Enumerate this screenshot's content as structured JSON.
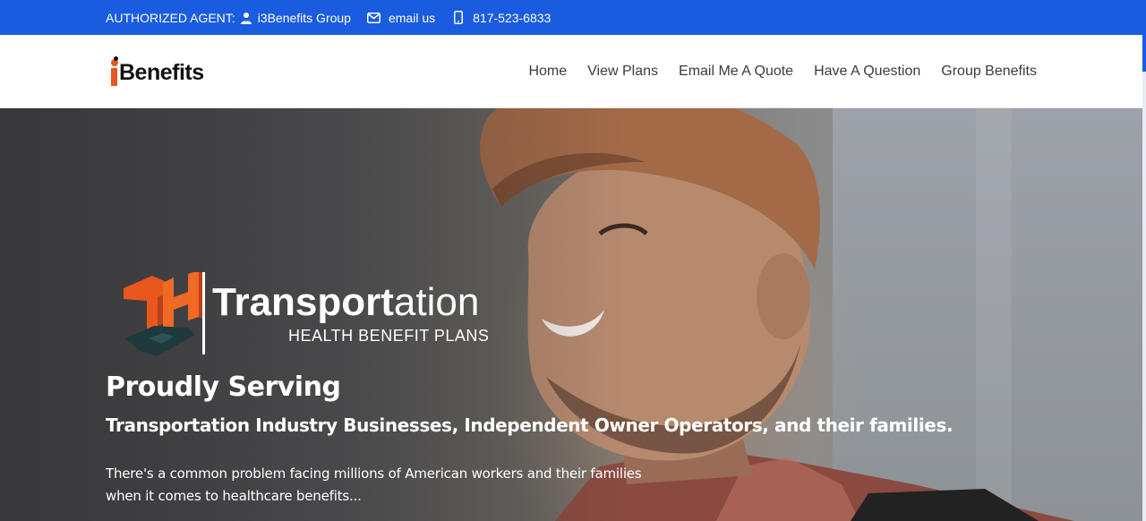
{
  "topbar": {
    "agent_label": "AUTHORIZED AGENT:",
    "agent_name": "i3Benefits Group",
    "email_label": "email us",
    "phone": "817-523-6833",
    "bg_color": "#1a5ce0",
    "icons": [
      "user-tie-icon",
      "envelope-icon",
      "mobile-phone-icon"
    ]
  },
  "header": {
    "logo_text": "Benefits",
    "nav": [
      {
        "label": "Home"
      },
      {
        "label": "View Plans"
      },
      {
        "label": "Email Me A Quote"
      },
      {
        "label": "Have A Question"
      },
      {
        "label": "Group Benefits"
      }
    ]
  },
  "hero": {
    "brand_bold": "Transport",
    "brand_light": "ation",
    "brand_subtitle": "HEALTH BENEFIT PLANS",
    "brand_mark_colors": {
      "orange": "#e8571d",
      "dark": "#1f3a3d"
    },
    "heading": "Proudly Serving",
    "subheading": "Transportation Industry Businesses, Independent Owner Operators, and their families.",
    "body_line1": "There's a common problem facing millions of American workers and their families",
    "body_line2": "when it comes to healthcare benefits..."
  }
}
